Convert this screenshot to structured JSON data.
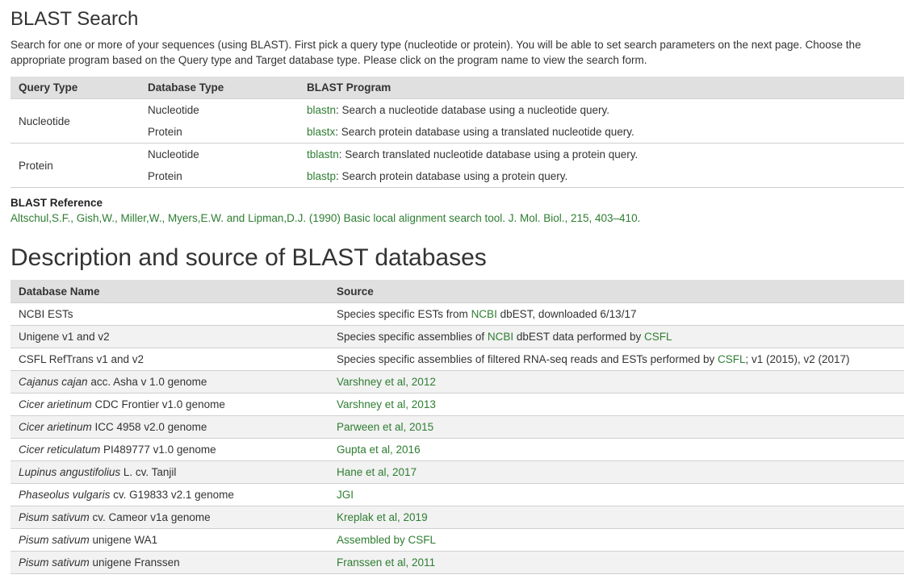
{
  "blast": {
    "title": "BLAST Search",
    "intro": "Search for one or more of your sequences (using BLAST). First pick a query type (nucleotide or protein). You will be able to set search parameters on the next page. Choose the appropriate program based on the Query type and Target database type. Please click on the program name to view the search form.",
    "headers": [
      "Query Type",
      "Database Type",
      "BLAST Program"
    ],
    "rows": [
      {
        "query": "Nucleotide",
        "db": "Nucleotide",
        "program": "blastn",
        "desc": ": Search a nucleotide database using a nucleotide query."
      },
      {
        "query": "",
        "db": "Protein",
        "program": "blastx",
        "desc": ": Search protein database using a translated nucleotide query."
      },
      {
        "query": "Protein",
        "db": "Nucleotide",
        "program": "tblastn",
        "desc": ": Search translated nucleotide database using a protein query."
      },
      {
        "query": "",
        "db": "Protein",
        "program": "blastp",
        "desc": ": Search protein database using a protein query."
      }
    ]
  },
  "reference": {
    "heading": "BLAST Reference",
    "citation": "Altschul,S.F., Gish,W., Miller,W., Myers,E.W. and Lipman,D.J. (1990) Basic local alignment search tool. J. Mol. Biol., 215, 403–410."
  },
  "databases": {
    "title": "Description and source of BLAST databases",
    "headers": [
      "Database Name",
      "Source"
    ],
    "rows": [
      {
        "name_italic": "",
        "name_rest": "NCBI ESTs",
        "src": [
          {
            "t": "Species specific ESTs from "
          },
          {
            "t": "NCBI",
            "link": true
          },
          {
            "t": " dbEST, downloaded 6/13/17"
          }
        ]
      },
      {
        "name_italic": "",
        "name_rest": "Unigene v1 and v2",
        "src": [
          {
            "t": "Species specific assemblies of "
          },
          {
            "t": "NCBI",
            "link": true
          },
          {
            "t": " dbEST data performed by "
          },
          {
            "t": "CSFL",
            "link": true
          }
        ]
      },
      {
        "name_italic": "",
        "name_rest": "CSFL RefTrans v1 and v2",
        "src": [
          {
            "t": "Species specific assemblies of filtered RNA-seq reads and ESTs performed by "
          },
          {
            "t": "CSFL",
            "link": true
          },
          {
            "t": "; v1 (2015), v2 (2017)"
          }
        ]
      },
      {
        "name_italic": "Cajanus cajan",
        "name_rest": " acc. Asha v 1.0 genome",
        "src": [
          {
            "t": "Varshney et al, 2012",
            "link": true
          }
        ]
      },
      {
        "name_italic": "Cicer arietinum",
        "name_rest": " CDC Frontier v1.0 genome",
        "src": [
          {
            "t": "Varshney et al, 2013",
            "link": true
          }
        ]
      },
      {
        "name_italic": "Cicer arietinum",
        "name_rest": " ICC 4958 v2.0 genome",
        "src": [
          {
            "t": "Parween et al, 2015",
            "link": true
          }
        ]
      },
      {
        "name_italic": "Cicer reticulatum",
        "name_rest": " PI489777 v1.0 genome",
        "src": [
          {
            "t": "Gupta et al, 2016",
            "link": true
          }
        ]
      },
      {
        "name_italic": "Lupinus angustifolius",
        "name_rest": " L. cv. Tanjil",
        "src": [
          {
            "t": "Hane et al, 2017",
            "link": true
          }
        ]
      },
      {
        "name_italic": "Phaseolus vulgaris",
        "name_rest": " cv. G19833 v2.1 genome",
        "src": [
          {
            "t": "JGI",
            "link": true
          }
        ]
      },
      {
        "name_italic": "Pisum sativum",
        "name_rest": " cv. Cameor v1a genome",
        "src": [
          {
            "t": "Kreplak et al, 2019",
            "link": true
          }
        ]
      },
      {
        "name_italic": "Pisum sativum",
        "name_rest": " unigene WA1",
        "src": [
          {
            "t": "Assembled by CSFL",
            "link": true
          }
        ]
      },
      {
        "name_italic": "Pisum sativum",
        "name_rest": " unigene Franssen",
        "src": [
          {
            "t": "Franssen et al, 2011",
            "link": true
          }
        ]
      }
    ]
  },
  "colors": {
    "link": "#2e7d32",
    "header_bg": "#e0e0e0",
    "alt_row": "#f2f2f2"
  }
}
